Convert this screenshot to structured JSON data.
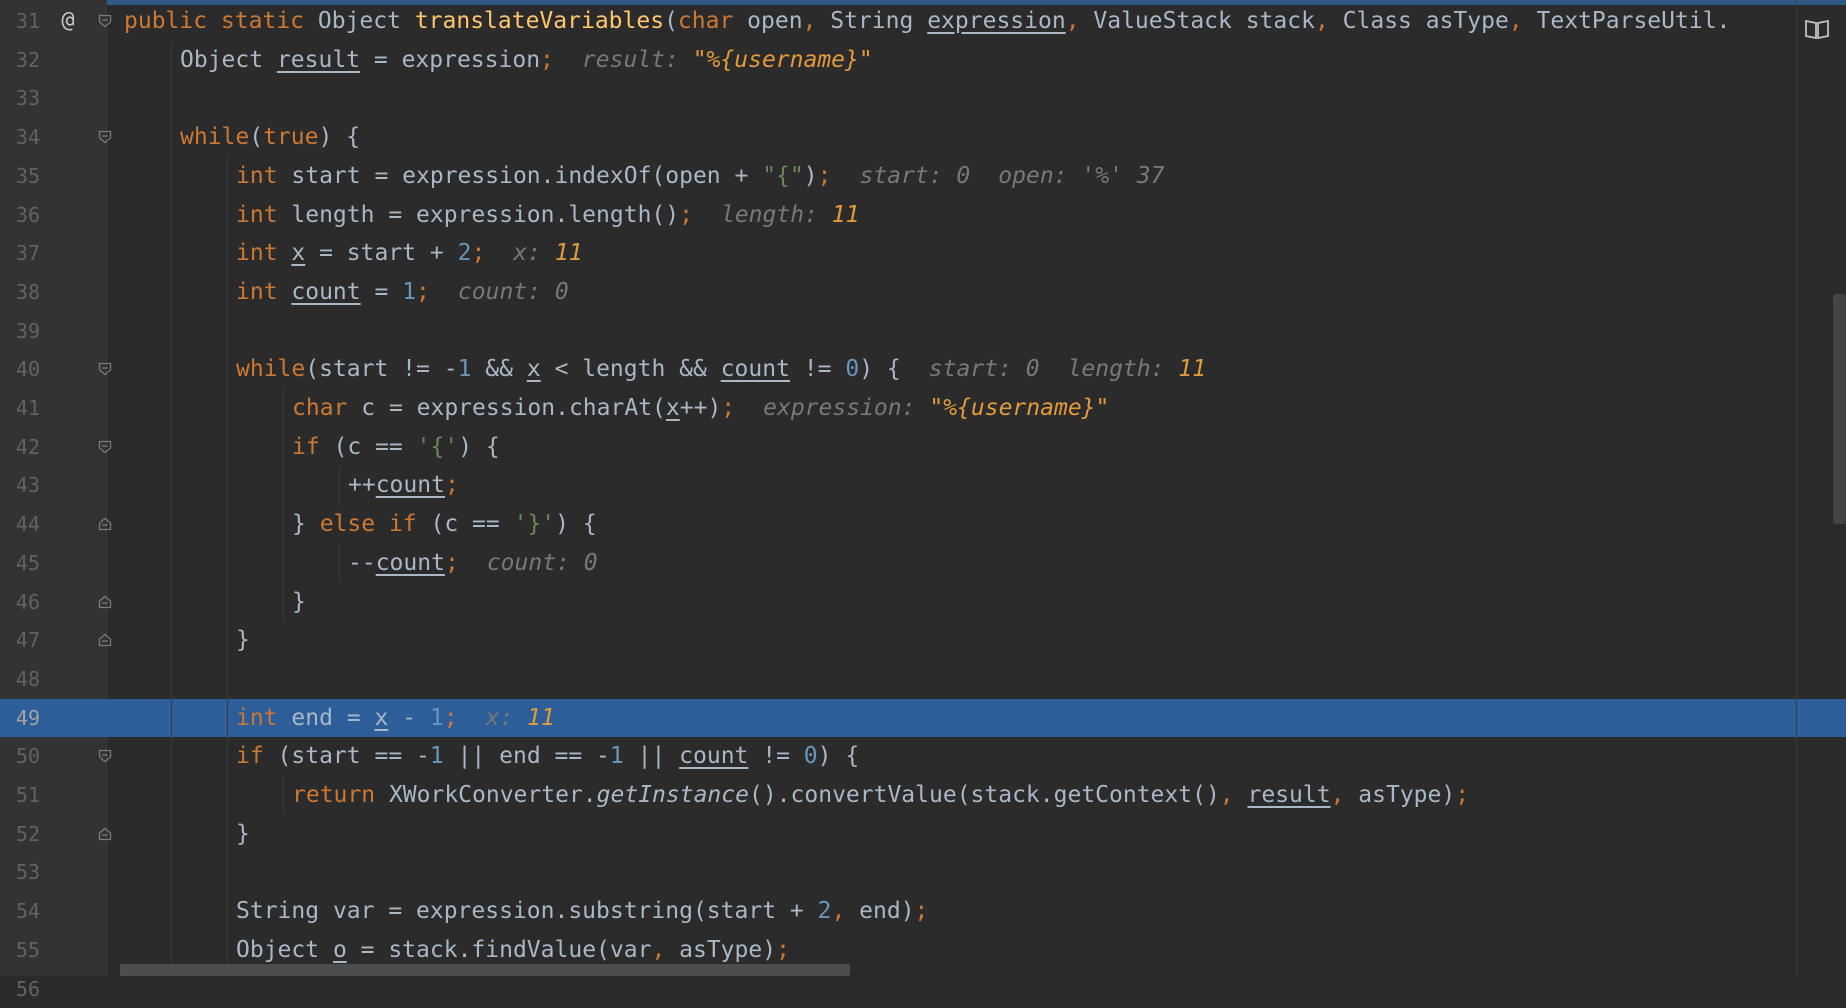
{
  "editor": {
    "highlighted_line": 49,
    "lines": [
      {
        "n": "31",
        "annotation": "@",
        "fold": "open",
        "indent": 1,
        "tokens": [
          {
            "t": "public static ",
            "c": "kw"
          },
          {
            "t": "Object ",
            "c": "pl"
          },
          {
            "t": "translateVariables",
            "c": "fn"
          },
          {
            "t": "(",
            "c": "pl"
          },
          {
            "t": "char ",
            "c": "kw"
          },
          {
            "t": "open",
            "c": "pl"
          },
          {
            "t": ", ",
            "c": "kw"
          },
          {
            "t": "String ",
            "c": "pl"
          },
          {
            "t": "expression",
            "c": "u"
          },
          {
            "t": ", ",
            "c": "kw"
          },
          {
            "t": "ValueStack stack",
            "c": "pl"
          },
          {
            "t": ", ",
            "c": "kw"
          },
          {
            "t": "Class asType",
            "c": "pl"
          },
          {
            "t": ", ",
            "c": "kw"
          },
          {
            "t": "TextParseUtil.",
            "c": "pl"
          }
        ],
        "hints": []
      },
      {
        "n": "32",
        "fold": "",
        "indent": 2,
        "tokens": [
          {
            "t": "Object ",
            "c": "pl"
          },
          {
            "t": "result",
            "c": "u"
          },
          {
            "t": " = expression",
            "c": "pl"
          },
          {
            "t": ";",
            "c": "kw"
          }
        ],
        "hints": [
          {
            "label": "result:",
            "value": "\"%{username}\""
          }
        ]
      },
      {
        "n": "33",
        "fold": "",
        "indent": 0,
        "tokens": [],
        "hints": []
      },
      {
        "n": "34",
        "fold": "open",
        "indent": 2,
        "tokens": [
          {
            "t": "while",
            "c": "kw"
          },
          {
            "t": "(",
            "c": "pl"
          },
          {
            "t": "true",
            "c": "kw"
          },
          {
            "t": ") {",
            "c": "pl"
          }
        ],
        "hints": []
      },
      {
        "n": "35",
        "fold": "",
        "indent": 3,
        "tokens": [
          {
            "t": "int ",
            "c": "kw"
          },
          {
            "t": "start = expression.indexOf(open + ",
            "c": "pl"
          },
          {
            "t": "\"{\"",
            "c": "str"
          },
          {
            "t": ")",
            "c": "pl"
          },
          {
            "t": ";",
            "c": "kw"
          }
        ],
        "hints": [
          {
            "label": "start:",
            "value": "0",
            "muted": true
          },
          {
            "label": "open:",
            "value": "'%' 37",
            "muted": true
          }
        ]
      },
      {
        "n": "36",
        "fold": "",
        "indent": 3,
        "tokens": [
          {
            "t": "int ",
            "c": "kw"
          },
          {
            "t": "length = expression.length()",
            "c": "pl"
          },
          {
            "t": ";",
            "c": "kw"
          }
        ],
        "hints": [
          {
            "label": "length:",
            "value": "11"
          }
        ]
      },
      {
        "n": "37",
        "fold": "",
        "indent": 3,
        "tokens": [
          {
            "t": "int ",
            "c": "kw"
          },
          {
            "t": "x",
            "c": "u"
          },
          {
            "t": " = start + ",
            "c": "pl"
          },
          {
            "t": "2",
            "c": "num"
          },
          {
            "t": ";",
            "c": "kw"
          }
        ],
        "hints": [
          {
            "label": "x:",
            "value": "11"
          }
        ]
      },
      {
        "n": "38",
        "fold": "",
        "indent": 3,
        "tokens": [
          {
            "t": "int ",
            "c": "kw"
          },
          {
            "t": "count",
            "c": "u"
          },
          {
            "t": " = ",
            "c": "pl"
          },
          {
            "t": "1",
            "c": "num"
          },
          {
            "t": ";",
            "c": "kw"
          }
        ],
        "hints": [
          {
            "label": "count:",
            "value": "0",
            "muted": true
          }
        ]
      },
      {
        "n": "39",
        "fold": "",
        "indent": 0,
        "tokens": [],
        "hints": []
      },
      {
        "n": "40",
        "fold": "open",
        "indent": 3,
        "tokens": [
          {
            "t": "while",
            "c": "kw"
          },
          {
            "t": "(start != -",
            "c": "pl"
          },
          {
            "t": "1",
            "c": "num"
          },
          {
            "t": " && ",
            "c": "pl"
          },
          {
            "t": "x",
            "c": "u"
          },
          {
            "t": " < length && ",
            "c": "pl"
          },
          {
            "t": "count",
            "c": "u"
          },
          {
            "t": " != ",
            "c": "pl"
          },
          {
            "t": "0",
            "c": "num"
          },
          {
            "t": ") {",
            "c": "pl"
          }
        ],
        "hints": [
          {
            "label": "start:",
            "value": "0",
            "muted": true
          },
          {
            "label": "length:",
            "value": "11"
          }
        ]
      },
      {
        "n": "41",
        "fold": "",
        "indent": 4,
        "tokens": [
          {
            "t": "char ",
            "c": "kw"
          },
          {
            "t": "c = expression.charAt(",
            "c": "pl"
          },
          {
            "t": "x",
            "c": "u"
          },
          {
            "t": "++)",
            "c": "pl"
          },
          {
            "t": ";",
            "c": "kw"
          }
        ],
        "hints": [
          {
            "label": "expression:",
            "value": "\"%{username}\""
          }
        ]
      },
      {
        "n": "42",
        "fold": "open",
        "indent": 4,
        "tokens": [
          {
            "t": "if ",
            "c": "kw"
          },
          {
            "t": "(c == ",
            "c": "pl"
          },
          {
            "t": "'{'",
            "c": "str"
          },
          {
            "t": ") {",
            "c": "pl"
          }
        ],
        "hints": []
      },
      {
        "n": "43",
        "fold": "",
        "indent": 5,
        "tokens": [
          {
            "t": "++",
            "c": "pl"
          },
          {
            "t": "count",
            "c": "u"
          },
          {
            "t": ";",
            "c": "kw"
          }
        ],
        "hints": []
      },
      {
        "n": "44",
        "fold": "close",
        "indent": 4,
        "tokens": [
          {
            "t": "} ",
            "c": "pl"
          },
          {
            "t": "else if ",
            "c": "kw"
          },
          {
            "t": "(c == ",
            "c": "pl"
          },
          {
            "t": "'}'",
            "c": "str"
          },
          {
            "t": ") {",
            "c": "pl"
          }
        ],
        "hints": []
      },
      {
        "n": "45",
        "fold": "",
        "indent": 5,
        "tokens": [
          {
            "t": "--",
            "c": "pl"
          },
          {
            "t": "count",
            "c": "u"
          },
          {
            "t": ";",
            "c": "kw"
          }
        ],
        "hints": [
          {
            "label": "count:",
            "value": "0",
            "muted": true
          }
        ]
      },
      {
        "n": "46",
        "fold": "close",
        "indent": 4,
        "tokens": [
          {
            "t": "}",
            "c": "pl"
          }
        ],
        "hints": []
      },
      {
        "n": "47",
        "fold": "close",
        "indent": 3,
        "tokens": [
          {
            "t": "}",
            "c": "pl"
          }
        ],
        "hints": []
      },
      {
        "n": "48",
        "fold": "",
        "indent": 0,
        "tokens": [],
        "hints": []
      },
      {
        "n": "49",
        "fold": "",
        "indent": 3,
        "tokens": [
          {
            "t": "int ",
            "c": "kw"
          },
          {
            "t": "end = ",
            "c": "pl"
          },
          {
            "t": "x",
            "c": "u"
          },
          {
            "t": " - ",
            "c": "pl"
          },
          {
            "t": "1",
            "c": "num"
          },
          {
            "t": ";",
            "c": "kw"
          }
        ],
        "hints": [
          {
            "label": "x:",
            "value": "11"
          }
        ]
      },
      {
        "n": "50",
        "fold": "open",
        "indent": 3,
        "tokens": [
          {
            "t": "if ",
            "c": "kw"
          },
          {
            "t": "(start == -",
            "c": "pl"
          },
          {
            "t": "1",
            "c": "num"
          },
          {
            "t": " || end == -",
            "c": "pl"
          },
          {
            "t": "1",
            "c": "num"
          },
          {
            "t": " || ",
            "c": "pl"
          },
          {
            "t": "count",
            "c": "u"
          },
          {
            "t": " != ",
            "c": "pl"
          },
          {
            "t": "0",
            "c": "num"
          },
          {
            "t": ") {",
            "c": "pl"
          }
        ],
        "hints": []
      },
      {
        "n": "51",
        "fold": "",
        "indent": 4,
        "tokens": [
          {
            "t": "return ",
            "c": "kw"
          },
          {
            "t": "XWorkConverter.",
            "c": "pl"
          },
          {
            "t": "getInstance",
            "c": "it"
          },
          {
            "t": "().convertValue(stack.getContext()",
            "c": "pl"
          },
          {
            "t": ", ",
            "c": "kw"
          },
          {
            "t": "result",
            "c": "u"
          },
          {
            "t": ", ",
            "c": "kw"
          },
          {
            "t": "asType)",
            "c": "pl"
          },
          {
            "t": ";",
            "c": "kw"
          }
        ],
        "hints": []
      },
      {
        "n": "52",
        "fold": "close",
        "indent": 3,
        "tokens": [
          {
            "t": "}",
            "c": "pl"
          }
        ],
        "hints": []
      },
      {
        "n": "53",
        "fold": "",
        "indent": 0,
        "tokens": [],
        "hints": []
      },
      {
        "n": "54",
        "fold": "",
        "indent": 3,
        "tokens": [
          {
            "t": "String ",
            "c": "pl"
          },
          {
            "t": "var = expression.substring(start + ",
            "c": "pl"
          },
          {
            "t": "2",
            "c": "num"
          },
          {
            "t": ", ",
            "c": "kw"
          },
          {
            "t": "end)",
            "c": "pl"
          },
          {
            "t": ";",
            "c": "kw"
          }
        ],
        "hints": []
      },
      {
        "n": "55",
        "fold": "",
        "indent": 3,
        "tokens": [
          {
            "t": "Object ",
            "c": "pl"
          },
          {
            "t": "o",
            "c": "u"
          },
          {
            "t": " = stack.findValue(var",
            "c": "pl"
          },
          {
            "t": ", ",
            "c": "kw"
          },
          {
            "t": "asType)",
            "c": "pl"
          },
          {
            "t": ";",
            "c": "kw"
          }
        ],
        "hints": []
      },
      {
        "n": "56",
        "fold": "",
        "indent": 3,
        "tokens": [],
        "hints": []
      }
    ]
  },
  "icons": {
    "annotation_marker": "at-sign-icon",
    "reader_mode": "book-icon"
  },
  "colors": {
    "background": "#2b2b2b",
    "gutter": "#313335",
    "highlight": "#2d5e99",
    "keyword": "#cc7832",
    "number": "#6897bb",
    "string": "#6a8759",
    "function": "#ffc66d",
    "hint_value": "#e29a3b"
  }
}
